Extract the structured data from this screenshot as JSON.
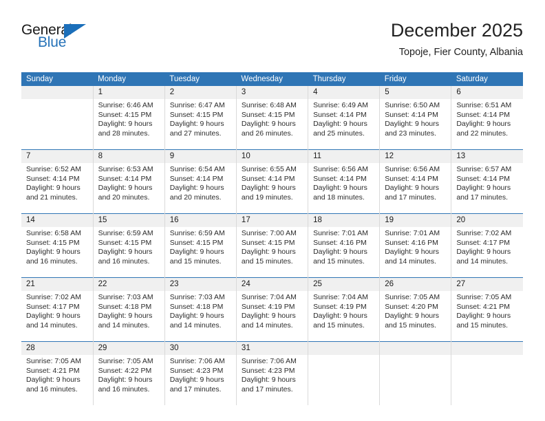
{
  "logo": {
    "word1": "General",
    "word2": "Blue",
    "triangle_color": "#1b6fba",
    "blue_text_color": "#2572b8"
  },
  "header": {
    "title": "December 2025",
    "subtitle": "Topoje, Fier County, Albania"
  },
  "theme": {
    "header_row_bg": "#2f75b5",
    "day_number_bg": "#f0f0f0",
    "separator_color": "#2f75b5",
    "text_color": "#2b2b2b"
  },
  "weekday_headers": [
    "Sunday",
    "Monday",
    "Tuesday",
    "Wednesday",
    "Thursday",
    "Friday",
    "Saturday"
  ],
  "weeks": [
    [
      {
        "day": "",
        "sunrise": "",
        "sunset": "",
        "daylight_line1": "",
        "daylight_line2": ""
      },
      {
        "day": "1",
        "sunrise": "Sunrise: 6:46 AM",
        "sunset": "Sunset: 4:15 PM",
        "daylight_line1": "Daylight: 9 hours",
        "daylight_line2": "and 28 minutes."
      },
      {
        "day": "2",
        "sunrise": "Sunrise: 6:47 AM",
        "sunset": "Sunset: 4:15 PM",
        "daylight_line1": "Daylight: 9 hours",
        "daylight_line2": "and 27 minutes."
      },
      {
        "day": "3",
        "sunrise": "Sunrise: 6:48 AM",
        "sunset": "Sunset: 4:15 PM",
        "daylight_line1": "Daylight: 9 hours",
        "daylight_line2": "and 26 minutes."
      },
      {
        "day": "4",
        "sunrise": "Sunrise: 6:49 AM",
        "sunset": "Sunset: 4:14 PM",
        "daylight_line1": "Daylight: 9 hours",
        "daylight_line2": "and 25 minutes."
      },
      {
        "day": "5",
        "sunrise": "Sunrise: 6:50 AM",
        "sunset": "Sunset: 4:14 PM",
        "daylight_line1": "Daylight: 9 hours",
        "daylight_line2": "and 23 minutes."
      },
      {
        "day": "6",
        "sunrise": "Sunrise: 6:51 AM",
        "sunset": "Sunset: 4:14 PM",
        "daylight_line1": "Daylight: 9 hours",
        "daylight_line2": "and 22 minutes."
      }
    ],
    [
      {
        "day": "7",
        "sunrise": "Sunrise: 6:52 AM",
        "sunset": "Sunset: 4:14 PM",
        "daylight_line1": "Daylight: 9 hours",
        "daylight_line2": "and 21 minutes."
      },
      {
        "day": "8",
        "sunrise": "Sunrise: 6:53 AM",
        "sunset": "Sunset: 4:14 PM",
        "daylight_line1": "Daylight: 9 hours",
        "daylight_line2": "and 20 minutes."
      },
      {
        "day": "9",
        "sunrise": "Sunrise: 6:54 AM",
        "sunset": "Sunset: 4:14 PM",
        "daylight_line1": "Daylight: 9 hours",
        "daylight_line2": "and 20 minutes."
      },
      {
        "day": "10",
        "sunrise": "Sunrise: 6:55 AM",
        "sunset": "Sunset: 4:14 PM",
        "daylight_line1": "Daylight: 9 hours",
        "daylight_line2": "and 19 minutes."
      },
      {
        "day": "11",
        "sunrise": "Sunrise: 6:56 AM",
        "sunset": "Sunset: 4:14 PM",
        "daylight_line1": "Daylight: 9 hours",
        "daylight_line2": "and 18 minutes."
      },
      {
        "day": "12",
        "sunrise": "Sunrise: 6:56 AM",
        "sunset": "Sunset: 4:14 PM",
        "daylight_line1": "Daylight: 9 hours",
        "daylight_line2": "and 17 minutes."
      },
      {
        "day": "13",
        "sunrise": "Sunrise: 6:57 AM",
        "sunset": "Sunset: 4:14 PM",
        "daylight_line1": "Daylight: 9 hours",
        "daylight_line2": "and 17 minutes."
      }
    ],
    [
      {
        "day": "14",
        "sunrise": "Sunrise: 6:58 AM",
        "sunset": "Sunset: 4:15 PM",
        "daylight_line1": "Daylight: 9 hours",
        "daylight_line2": "and 16 minutes."
      },
      {
        "day": "15",
        "sunrise": "Sunrise: 6:59 AM",
        "sunset": "Sunset: 4:15 PM",
        "daylight_line1": "Daylight: 9 hours",
        "daylight_line2": "and 16 minutes."
      },
      {
        "day": "16",
        "sunrise": "Sunrise: 6:59 AM",
        "sunset": "Sunset: 4:15 PM",
        "daylight_line1": "Daylight: 9 hours",
        "daylight_line2": "and 15 minutes."
      },
      {
        "day": "17",
        "sunrise": "Sunrise: 7:00 AM",
        "sunset": "Sunset: 4:15 PM",
        "daylight_line1": "Daylight: 9 hours",
        "daylight_line2": "and 15 minutes."
      },
      {
        "day": "18",
        "sunrise": "Sunrise: 7:01 AM",
        "sunset": "Sunset: 4:16 PM",
        "daylight_line1": "Daylight: 9 hours",
        "daylight_line2": "and 15 minutes."
      },
      {
        "day": "19",
        "sunrise": "Sunrise: 7:01 AM",
        "sunset": "Sunset: 4:16 PM",
        "daylight_line1": "Daylight: 9 hours",
        "daylight_line2": "and 14 minutes."
      },
      {
        "day": "20",
        "sunrise": "Sunrise: 7:02 AM",
        "sunset": "Sunset: 4:17 PM",
        "daylight_line1": "Daylight: 9 hours",
        "daylight_line2": "and 14 minutes."
      }
    ],
    [
      {
        "day": "21",
        "sunrise": "Sunrise: 7:02 AM",
        "sunset": "Sunset: 4:17 PM",
        "daylight_line1": "Daylight: 9 hours",
        "daylight_line2": "and 14 minutes."
      },
      {
        "day": "22",
        "sunrise": "Sunrise: 7:03 AM",
        "sunset": "Sunset: 4:18 PM",
        "daylight_line1": "Daylight: 9 hours",
        "daylight_line2": "and 14 minutes."
      },
      {
        "day": "23",
        "sunrise": "Sunrise: 7:03 AM",
        "sunset": "Sunset: 4:18 PM",
        "daylight_line1": "Daylight: 9 hours",
        "daylight_line2": "and 14 minutes."
      },
      {
        "day": "24",
        "sunrise": "Sunrise: 7:04 AM",
        "sunset": "Sunset: 4:19 PM",
        "daylight_line1": "Daylight: 9 hours",
        "daylight_line2": "and 14 minutes."
      },
      {
        "day": "25",
        "sunrise": "Sunrise: 7:04 AM",
        "sunset": "Sunset: 4:19 PM",
        "daylight_line1": "Daylight: 9 hours",
        "daylight_line2": "and 15 minutes."
      },
      {
        "day": "26",
        "sunrise": "Sunrise: 7:05 AM",
        "sunset": "Sunset: 4:20 PM",
        "daylight_line1": "Daylight: 9 hours",
        "daylight_line2": "and 15 minutes."
      },
      {
        "day": "27",
        "sunrise": "Sunrise: 7:05 AM",
        "sunset": "Sunset: 4:21 PM",
        "daylight_line1": "Daylight: 9 hours",
        "daylight_line2": "and 15 minutes."
      }
    ],
    [
      {
        "day": "28",
        "sunrise": "Sunrise: 7:05 AM",
        "sunset": "Sunset: 4:21 PM",
        "daylight_line1": "Daylight: 9 hours",
        "daylight_line2": "and 16 minutes."
      },
      {
        "day": "29",
        "sunrise": "Sunrise: 7:05 AM",
        "sunset": "Sunset: 4:22 PM",
        "daylight_line1": "Daylight: 9 hours",
        "daylight_line2": "and 16 minutes."
      },
      {
        "day": "30",
        "sunrise": "Sunrise: 7:06 AM",
        "sunset": "Sunset: 4:23 PM",
        "daylight_line1": "Daylight: 9 hours",
        "daylight_line2": "and 17 minutes."
      },
      {
        "day": "31",
        "sunrise": "Sunrise: 7:06 AM",
        "sunset": "Sunset: 4:23 PM",
        "daylight_line1": "Daylight: 9 hours",
        "daylight_line2": "and 17 minutes."
      },
      {
        "day": "",
        "sunrise": "",
        "sunset": "",
        "daylight_line1": "",
        "daylight_line2": ""
      },
      {
        "day": "",
        "sunrise": "",
        "sunset": "",
        "daylight_line1": "",
        "daylight_line2": ""
      },
      {
        "day": "",
        "sunrise": "",
        "sunset": "",
        "daylight_line1": "",
        "daylight_line2": ""
      }
    ]
  ]
}
